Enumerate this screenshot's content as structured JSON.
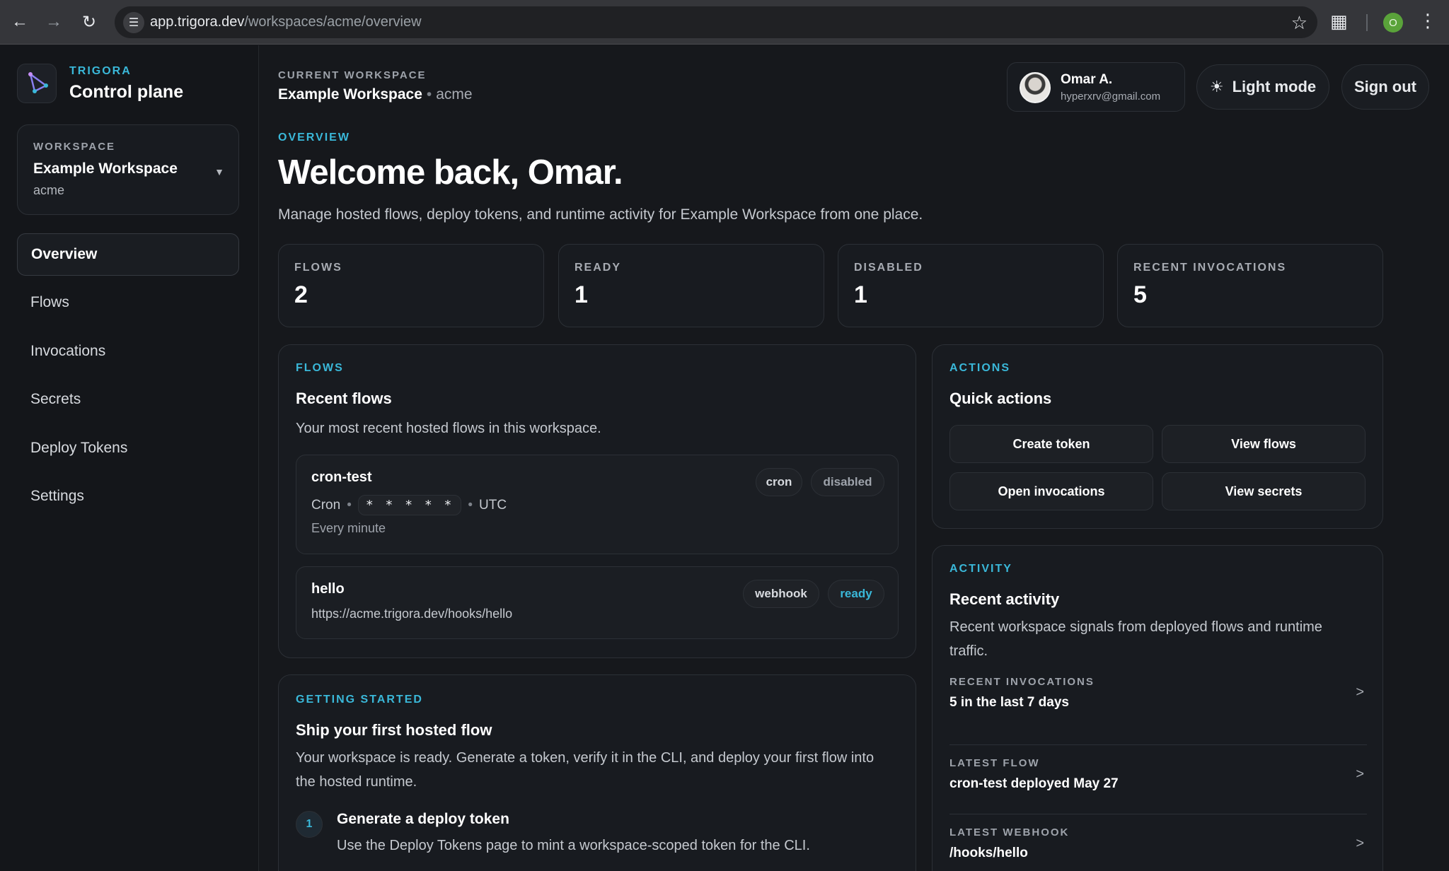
{
  "browser": {
    "url_host": "app.trigora.dev",
    "url_path": "/workspaces/acme/overview",
    "profile_initial": "O"
  },
  "sidebar": {
    "brand_small": "TRIGORA",
    "brand_title": "Control plane",
    "workspace_label": "WORKSPACE",
    "workspace_name": "Example Workspace",
    "workspace_slug": "acme",
    "items": [
      {
        "label": "Overview",
        "active": true
      },
      {
        "label": "Flows"
      },
      {
        "label": "Invocations"
      },
      {
        "label": "Secrets"
      },
      {
        "label": "Deploy Tokens"
      },
      {
        "label": "Settings"
      }
    ]
  },
  "header": {
    "current_label": "CURRENT WORKSPACE",
    "workspace_name": "Example Workspace",
    "workspace_slug": "acme",
    "user_name": "Omar A.",
    "user_email": "hyperxrv@gmail.com",
    "light_mode_label": "Light mode",
    "sign_out_label": "Sign out"
  },
  "overview": {
    "label": "OVERVIEW",
    "title": "Welcome back, Omar.",
    "subtitle": "Manage hosted flows, deploy tokens, and runtime activity for Example Workspace from one place."
  },
  "stats": [
    {
      "label": "FLOWS",
      "value": "2"
    },
    {
      "label": "READY",
      "value": "1"
    },
    {
      "label": "DISABLED",
      "value": "1"
    },
    {
      "label": "RECENT INVOCATIONS",
      "value": "5"
    }
  ],
  "flows_card": {
    "label": "FLOWS",
    "title": "Recent flows",
    "desc": "Your most recent hosted flows in this workspace.",
    "items": [
      {
        "name": "cron-test",
        "type_text": "Cron",
        "cron_expr": "* * * * *",
        "tz": "UTC",
        "sub": "Every minute",
        "badge_type": "cron",
        "badge_status": "disabled"
      },
      {
        "name": "hello",
        "url": "https://acme.trigora.dev/hooks/hello",
        "badge_type": "webhook",
        "badge_status": "ready"
      }
    ]
  },
  "actions_card": {
    "label": "ACTIONS",
    "title": "Quick actions",
    "buttons": [
      "Create token",
      "View flows",
      "Open invocations",
      "View secrets"
    ]
  },
  "activity_card": {
    "label": "ACTIVITY",
    "title": "Recent activity",
    "desc": "Recent workspace signals from deployed flows and runtime traffic.",
    "rows": [
      {
        "label": "RECENT INVOCATIONS",
        "value": "5 in the last 7 days"
      },
      {
        "label": "LATEST FLOW",
        "value": "cron-test deployed May 27"
      },
      {
        "label": "LATEST WEBHOOK",
        "value": "/hooks/hello"
      }
    ]
  },
  "getting_started": {
    "label": "GETTING STARTED",
    "title": "Ship your first hosted flow",
    "desc": "Your workspace is ready. Generate a token, verify it in the CLI, and deploy your first flow into the hosted runtime.",
    "steps": [
      {
        "num": "1",
        "title": "Generate a deploy token",
        "desc": "Use the Deploy Tokens page to mint a workspace-scoped token for the CLI."
      }
    ]
  },
  "colors": {
    "accent": "#3ab8d9",
    "background": "#16181c",
    "card": "#181b20"
  }
}
